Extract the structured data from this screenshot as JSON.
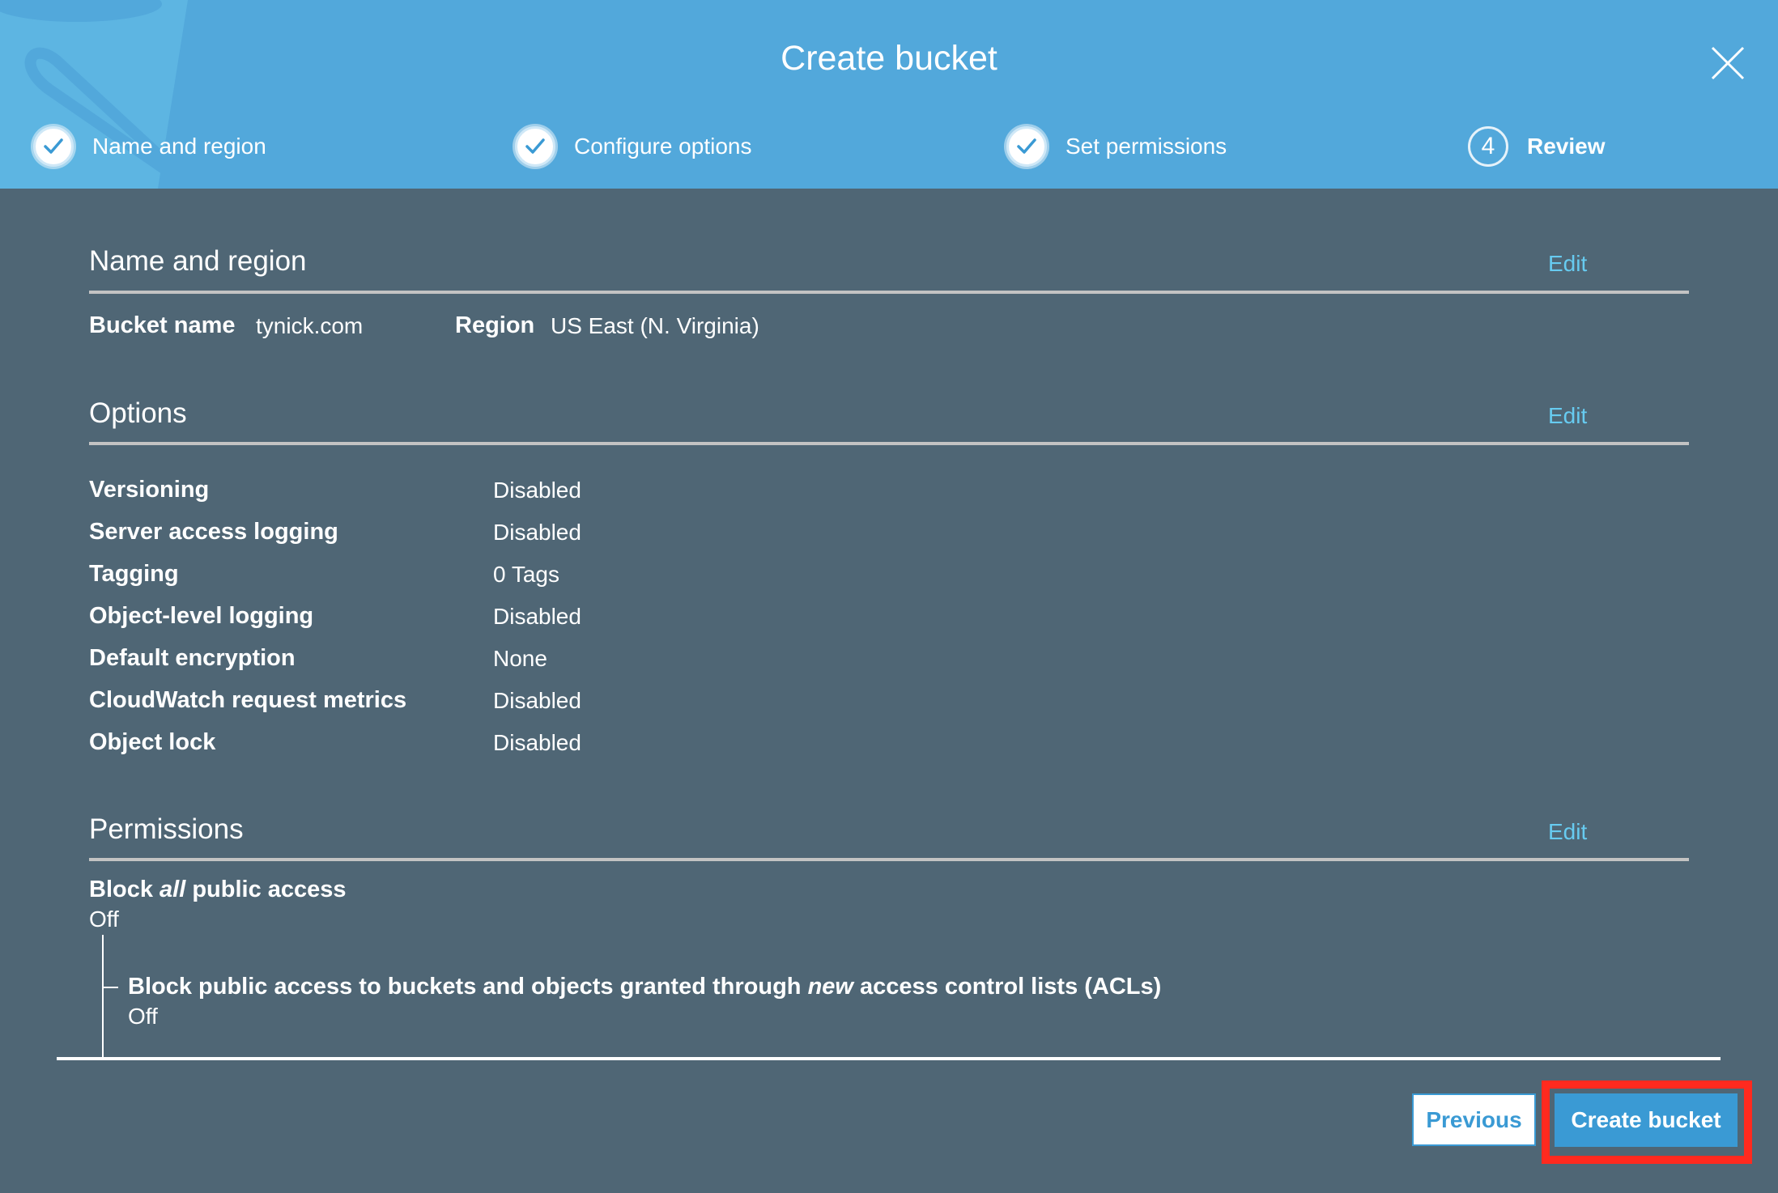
{
  "header": {
    "title": "Create bucket",
    "close_icon": "close-icon",
    "steps": [
      {
        "label": "Name and region",
        "status": "complete",
        "icon": "check-icon"
      },
      {
        "label": "Configure options",
        "status": "complete",
        "icon": "check-icon"
      },
      {
        "label": "Set permissions",
        "status": "complete",
        "icon": "check-icon"
      },
      {
        "label": "Review",
        "status": "current",
        "number": "4"
      }
    ]
  },
  "sections": {
    "name_region": {
      "heading": "Name and region",
      "edit_label": "Edit",
      "bucket_name_label": "Bucket name",
      "bucket_name_value": "tynick.com",
      "region_label": "Region",
      "region_value": "US East (N. Virginia)"
    },
    "options": {
      "heading": "Options",
      "edit_label": "Edit",
      "rows": [
        {
          "label": "Versioning",
          "value": "Disabled"
        },
        {
          "label": "Server access logging",
          "value": "Disabled"
        },
        {
          "label": "Tagging",
          "value": "0 Tags"
        },
        {
          "label": "Object-level logging",
          "value": "Disabled"
        },
        {
          "label": "Default encryption",
          "value": "None"
        },
        {
          "label": "CloudWatch request metrics",
          "value": "Disabled"
        },
        {
          "label": "Object lock",
          "value": "Disabled"
        }
      ]
    },
    "permissions": {
      "heading": "Permissions",
      "edit_label": "Edit",
      "block_all": {
        "label_pre": "Block ",
        "label_em": "all",
        "label_post": " public access",
        "value": "Off"
      },
      "sub_items": [
        {
          "label_pre": "Block public access to buckets and objects granted through ",
          "label_em": "new",
          "label_post": " access control lists (ACLs)",
          "value": "Off"
        }
      ]
    }
  },
  "footer": {
    "previous_label": "Previous",
    "create_label": "Create bucket"
  },
  "colors": {
    "header_bg": "#52a8db",
    "body_bg": "#4f6675",
    "link": "#67cbf0",
    "primary_button": "#3a9ad4",
    "highlight": "#ff2a1f"
  }
}
